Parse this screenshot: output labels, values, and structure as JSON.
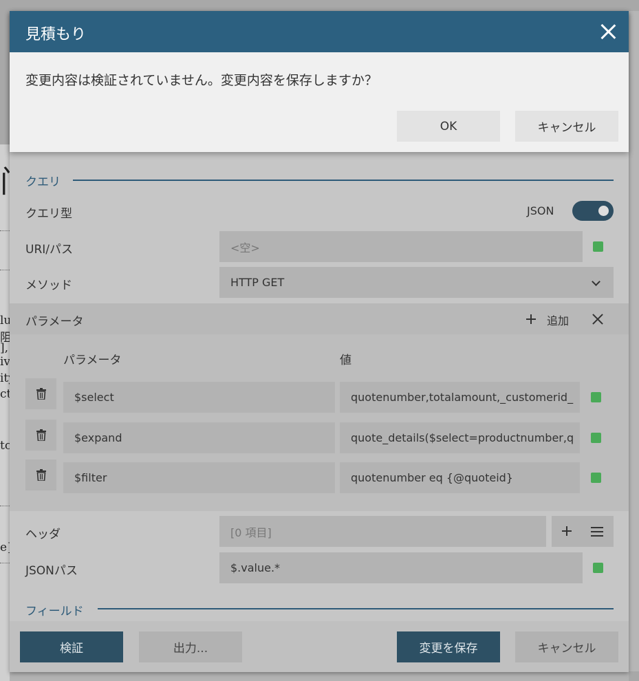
{
  "confirm_dialog": {
    "title": "見積もり",
    "message": "変更内容は検証されていません。変更内容を保存しますか？",
    "ok_label": "OK",
    "cancel_label": "キャンセル"
  },
  "background": {
    "fragments": [
      "lu",
      "阻",
      "],",
      "iv",
      "ity",
      "ct",
      "tc",
      "e}"
    ]
  },
  "query_section": {
    "heading": "クエリ",
    "query_type_label": "クエリ型",
    "query_type_value": "JSON",
    "uri_label": "URI/パス",
    "uri_placeholder": "<空>",
    "method_label": "メソッド",
    "method_value": "HTTP GET"
  },
  "params": {
    "bar_label": "パラメータ",
    "add_label": "追加",
    "col_name": "パラメータ",
    "col_value": "値",
    "rows": [
      {
        "name": "$select",
        "value": "quotenumber,totalamount,_customerid_"
      },
      {
        "name": "$expand",
        "value": "quote_details($select=productnumber,q"
      },
      {
        "name": "$filter",
        "value": "quotenumber eq {@quoteid}"
      }
    ]
  },
  "headers": {
    "label": "ヘッダ",
    "value": "[0 項目]"
  },
  "json_path": {
    "label": "JSONパス",
    "value": "$.value.*"
  },
  "fields_section": {
    "heading": "フィールド"
  },
  "footer": {
    "validate_label": "検証",
    "output_label": "出力...",
    "save_label": "変更を保存",
    "cancel_label": "キャンセル"
  },
  "colors": {
    "title_bar": "#2c6080",
    "primary_button": "#2d5064",
    "status_ok": "#4aaa58",
    "accent": "#2d5a78"
  }
}
